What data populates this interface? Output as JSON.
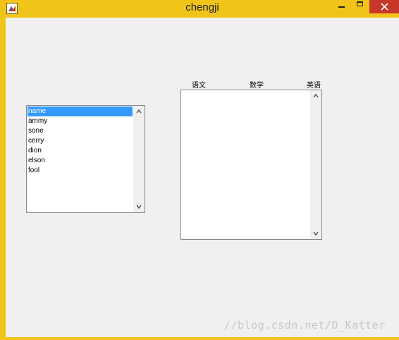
{
  "window": {
    "title": "chengji",
    "accent_color": "#f0c419",
    "close_color": "#c7382a"
  },
  "listbox_names": {
    "items": [
      "name",
      "ammy",
      "sone",
      "cerry",
      "dion",
      "elson",
      "fool"
    ],
    "selected_index": 0
  },
  "score_panel": {
    "headers": [
      "语文",
      "数学",
      "英语"
    ],
    "rows": []
  },
  "watermark": "//blog.csdn.net/D_Katter"
}
